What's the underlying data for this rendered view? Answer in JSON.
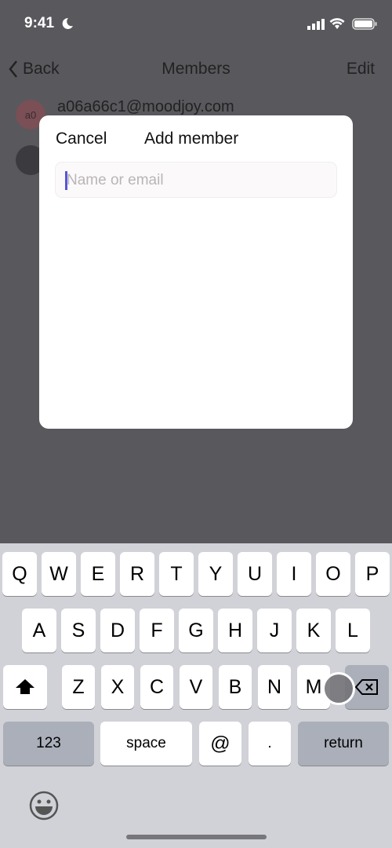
{
  "status_bar": {
    "time": "9:41",
    "icons": [
      "moon-icon",
      "signal-icon",
      "wifi-icon",
      "battery-icon"
    ]
  },
  "nav": {
    "back": "Back",
    "title": "Members",
    "edit": "Edit"
  },
  "members": [
    {
      "avatar_text": "a0",
      "email": "a06a66c1@moodjoy.com"
    },
    {
      "avatar_text": ""
    }
  ],
  "modal": {
    "cancel": "Cancel",
    "title": "Add member",
    "input_placeholder": "Name or email",
    "input_value": ""
  },
  "keyboard": {
    "row1": [
      "Q",
      "W",
      "E",
      "R",
      "T",
      "Y",
      "U",
      "I",
      "O",
      "P"
    ],
    "row2": [
      "A",
      "S",
      "D",
      "F",
      "G",
      "H",
      "J",
      "K",
      "L"
    ],
    "row3": [
      "Z",
      "X",
      "C",
      "V",
      "B",
      "N",
      "M"
    ],
    "numbers": "123",
    "space": "space",
    "at": "@",
    "dot": ".",
    "return": "return"
  },
  "colors": {
    "overlay": "#59585d",
    "cursor": "#5856d6",
    "keyboard_bg": "#d1d2d8"
  }
}
